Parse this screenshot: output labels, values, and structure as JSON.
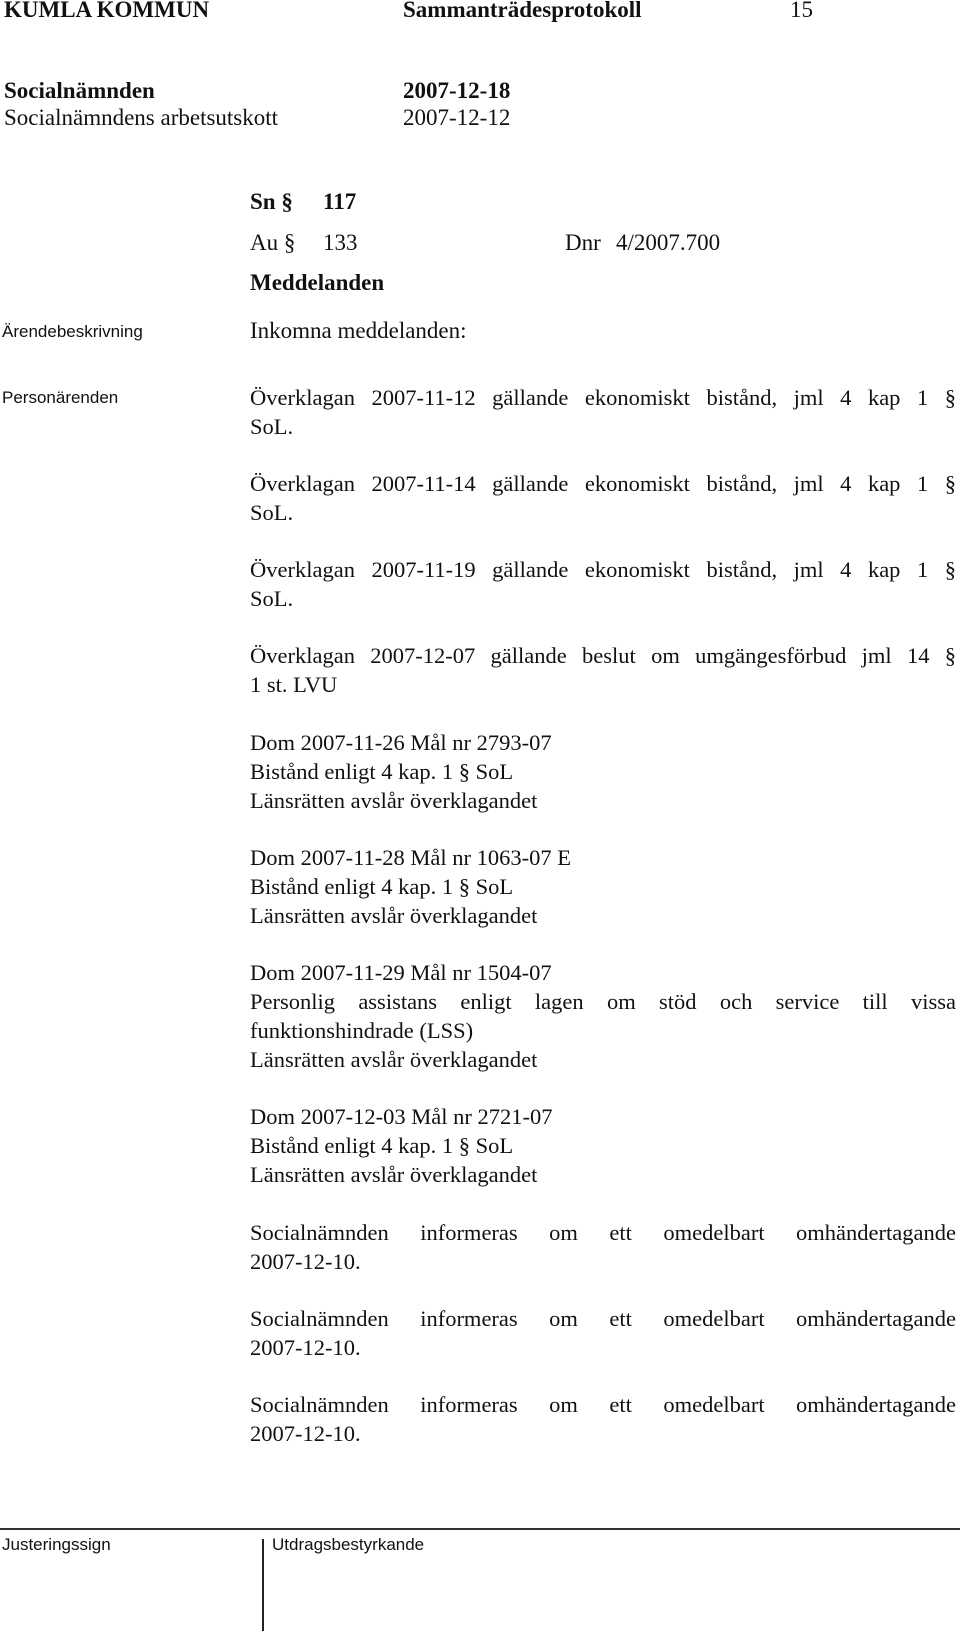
{
  "header": {
    "organization": "KUMLA KOMMUN",
    "document_type": "Sammanträdesprotokoll",
    "page_number": "15",
    "board": "Socialnämnden",
    "board_date": "2007-12-18",
    "committee": "Socialnämndens arbetsutskott",
    "committee_date": "2007-12-12"
  },
  "case": {
    "sn_label": "Sn §",
    "sn_number": "117",
    "au_label": "Au §",
    "au_number": "133",
    "dnr_label": "Dnr",
    "dnr_value": "4/2007.700",
    "title": "Meddelanden"
  },
  "sidebar": {
    "description_label": "Ärendebeskrivning",
    "personal_label": "Personärenden"
  },
  "body": {
    "intro": "Inkomna meddelanden:",
    "appeals": [
      {
        "line1": "Överklagan 2007-11-12 gällande ekonomiskt bistånd, jml 4 kap 1 §",
        "line2": "SoL."
      },
      {
        "line1": "Överklagan 2007-11-14 gällande ekonomiskt bistånd, jml 4 kap 1 §",
        "line2": "SoL."
      },
      {
        "line1": "Överklagan 2007-11-19 gällande ekonomiskt bistånd, jml 4 kap 1 §",
        "line2": "SoL."
      },
      {
        "line1": "Överklagan 2007-12-07 gällande beslut om umgängesförbud jml 14 §",
        "line2": "1 st. LVU"
      }
    ],
    "judgments": [
      {
        "case": "Dom 2007-11-26 Mål nr 2793-07",
        "subject": "Bistånd enligt 4 kap. 1 § SoL",
        "subject2": "",
        "outcome": "Länsrätten avslår överklagandet"
      },
      {
        "case": "Dom 2007-11-28 Mål nr 1063-07 E",
        "subject": "Bistånd enligt 4 kap. 1 § SoL",
        "subject2": "",
        "outcome": "Länsrätten avslår överklagandet"
      },
      {
        "case": "Dom 2007-11-29 Mål nr 1504-07",
        "subject": "Personlig assistans enligt lagen om stöd och service till vissa",
        "subject2": "funktionshindrade (LSS)",
        "outcome": "Länsrätten avslår överklagandet"
      },
      {
        "case": "Dom 2007-12-03 Mål nr 2721-07",
        "subject": "Bistånd enligt 4 kap. 1 § SoL",
        "subject2": "",
        "outcome": "Länsrätten avslår överklagandet"
      }
    ],
    "notices": [
      {
        "line1": "Socialnämnden informeras om ett omedelbart omhändertagande",
        "line2": "2007-12-10."
      },
      {
        "line1": "Socialnämnden informeras om ett omedelbart omhändertagande",
        "line2": "2007-12-10."
      },
      {
        "line1": "Socialnämnden informeras om ett omedelbart omhändertagande",
        "line2": "2007-12-10."
      }
    ]
  },
  "footer": {
    "adjust_sign_label": "Justeringssign",
    "extract_cert_label": "Utdragsbestyrkande"
  }
}
